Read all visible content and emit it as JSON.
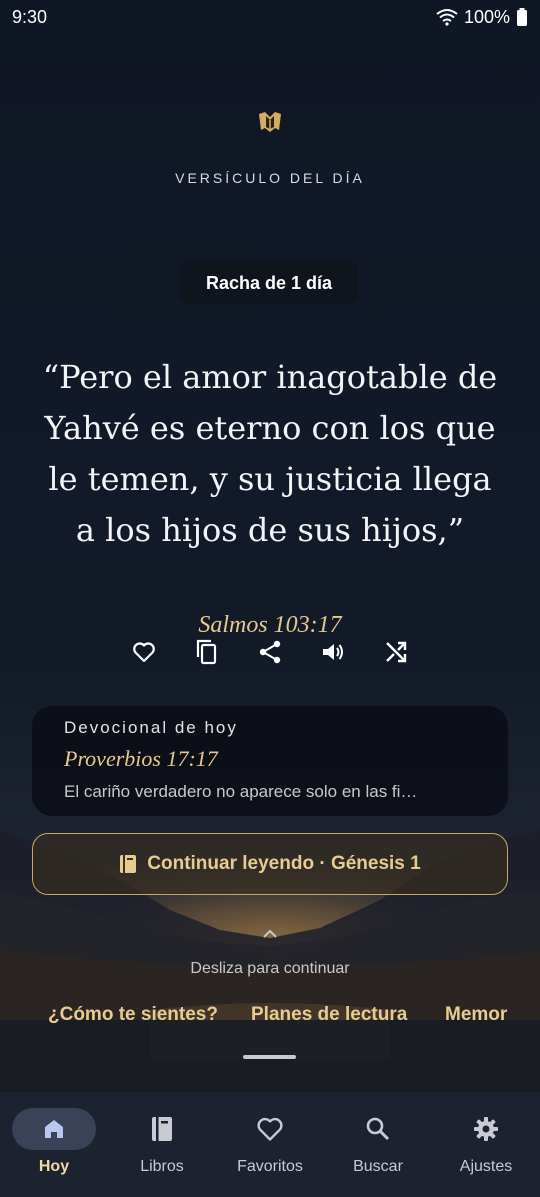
{
  "status_bar": {
    "time": "9:30",
    "battery": "100%"
  },
  "header": {
    "kicker": "VERSÍCULO DEL DÍA",
    "streak": "Racha de 1 día"
  },
  "verse": {
    "text_lines": [
      "“Pero el amor inagotable de",
      "Yahvé es eterno con los que",
      "le temen, y su justicia llega",
      "a los hijos de sus hijos,”"
    ],
    "reference": "Salmos 103:17"
  },
  "actions": [
    {
      "name": "favorite",
      "icon": "heart-outline-icon"
    },
    {
      "name": "copy",
      "icon": "copy-icon"
    },
    {
      "name": "share",
      "icon": "share-icon"
    },
    {
      "name": "listen",
      "icon": "volume-icon"
    },
    {
      "name": "shuffle",
      "icon": "shuffle-icon"
    }
  ],
  "devotional": {
    "title": "Devocional de hoy",
    "reference": "Proverbios 17:17",
    "excerpt": "El cariño verdadero no aparece solo en las fi…"
  },
  "continue_button": {
    "label": "Continuar leyendo · Génesis 1",
    "icon": "book-icon"
  },
  "swipe_hint": "Desliza para continuar",
  "chips": [
    "¿Cómo te sientes?",
    "Planes de lectura",
    "Memor"
  ],
  "bottom_nav": [
    {
      "label": "Hoy",
      "icon": "home-icon",
      "active": true
    },
    {
      "label": "Libros",
      "icon": "book-icon",
      "active": false
    },
    {
      "label": "Favoritos",
      "icon": "heart-outline-icon",
      "active": false
    },
    {
      "label": "Buscar",
      "icon": "search-icon",
      "active": false
    },
    {
      "label": "Ajustes",
      "icon": "gear-icon",
      "active": false
    }
  ],
  "colors": {
    "accent_gold": "#e7c98f",
    "nav_background": "#1c2230",
    "nav_active_pill": "#3a4257"
  }
}
